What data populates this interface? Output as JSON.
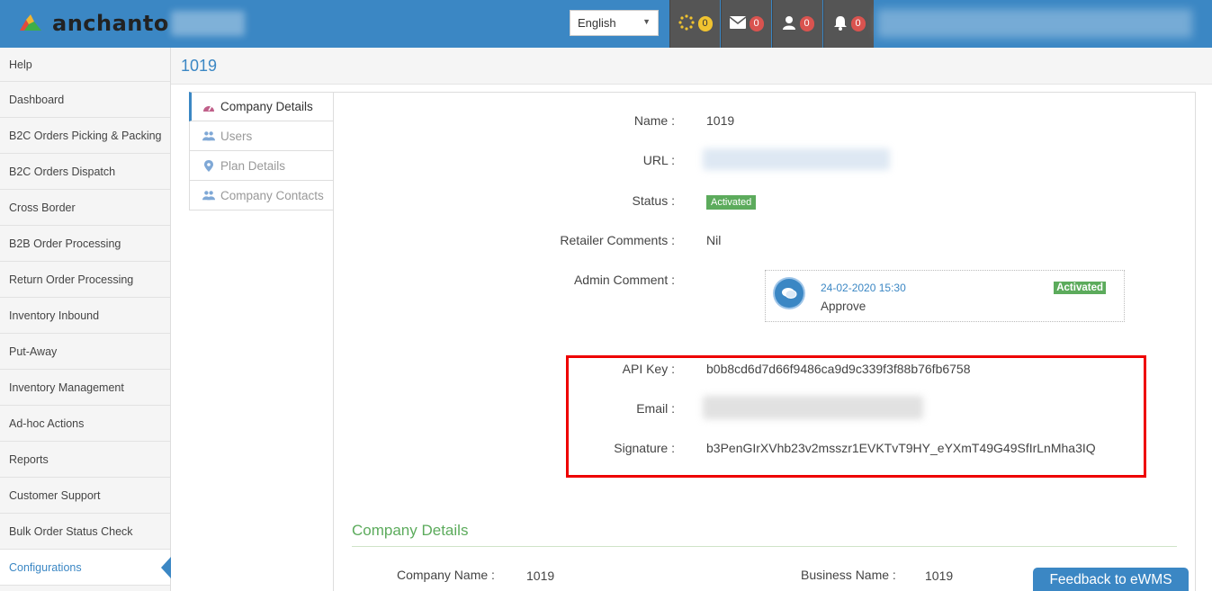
{
  "header": {
    "logo_text": "anchanto",
    "language": "English",
    "buttons": [
      {
        "icon": "spinner-icon",
        "count": "0"
      },
      {
        "icon": "envelope-icon",
        "count": "0"
      },
      {
        "icon": "user-icon",
        "count": "0"
      },
      {
        "icon": "bell-icon",
        "count": "0"
      }
    ]
  },
  "sidebar": {
    "items": [
      {
        "label": "Help"
      },
      {
        "label": "Dashboard"
      },
      {
        "label": "B2C Orders Picking & Packing"
      },
      {
        "label": "B2C Orders Dispatch"
      },
      {
        "label": "Cross Border"
      },
      {
        "label": "B2B Order Processing"
      },
      {
        "label": "Return Order Processing"
      },
      {
        "label": "Inventory Inbound"
      },
      {
        "label": "Put-Away"
      },
      {
        "label": "Inventory Management"
      },
      {
        "label": "Ad-hoc Actions"
      },
      {
        "label": "Reports"
      },
      {
        "label": "Customer Support"
      },
      {
        "label": "Bulk Order Status Check"
      },
      {
        "label": "Configurations"
      }
    ]
  },
  "breadcrumb": {
    "title": "1019"
  },
  "tabs": [
    {
      "label": "Company Details"
    },
    {
      "label": "Users"
    },
    {
      "label": "Plan Details"
    },
    {
      "label": "Company Contacts"
    }
  ],
  "details": {
    "name_label": "Name :",
    "name_value": "1019",
    "url_label": "URL :",
    "status_label": "Status :",
    "status_value": "Activated",
    "retailer_comments_label": "Retailer Comments :",
    "retailer_comments_value": "Nil",
    "admin_comment_label": "Admin Comment :",
    "comment": {
      "date": "24-02-2020 15:30",
      "status": "Activated",
      "text": "Approve"
    },
    "api_key_label": "API Key :",
    "api_key_value": "b0b8cd6d7d66f9486ca9d9c339f3f88b76fb6758",
    "email_label": "Email :",
    "signature_label": "Signature :",
    "signature_value": "b3PenGIrXVhb23v2msszr1EVKTvT9HY_eYXmT49G49SfIrLnMha3IQ"
  },
  "company_details": {
    "section_title": "Company Details",
    "company_name_label": "Company Name :",
    "company_name_value": "1019",
    "business_name_label": "Business Name :",
    "business_name_value": "1019"
  },
  "feedback": {
    "label": "Feedback to eWMS"
  },
  "colors": {
    "primary": "#3b87c4",
    "success": "#5cab5c",
    "highlight": "#ee0000"
  }
}
